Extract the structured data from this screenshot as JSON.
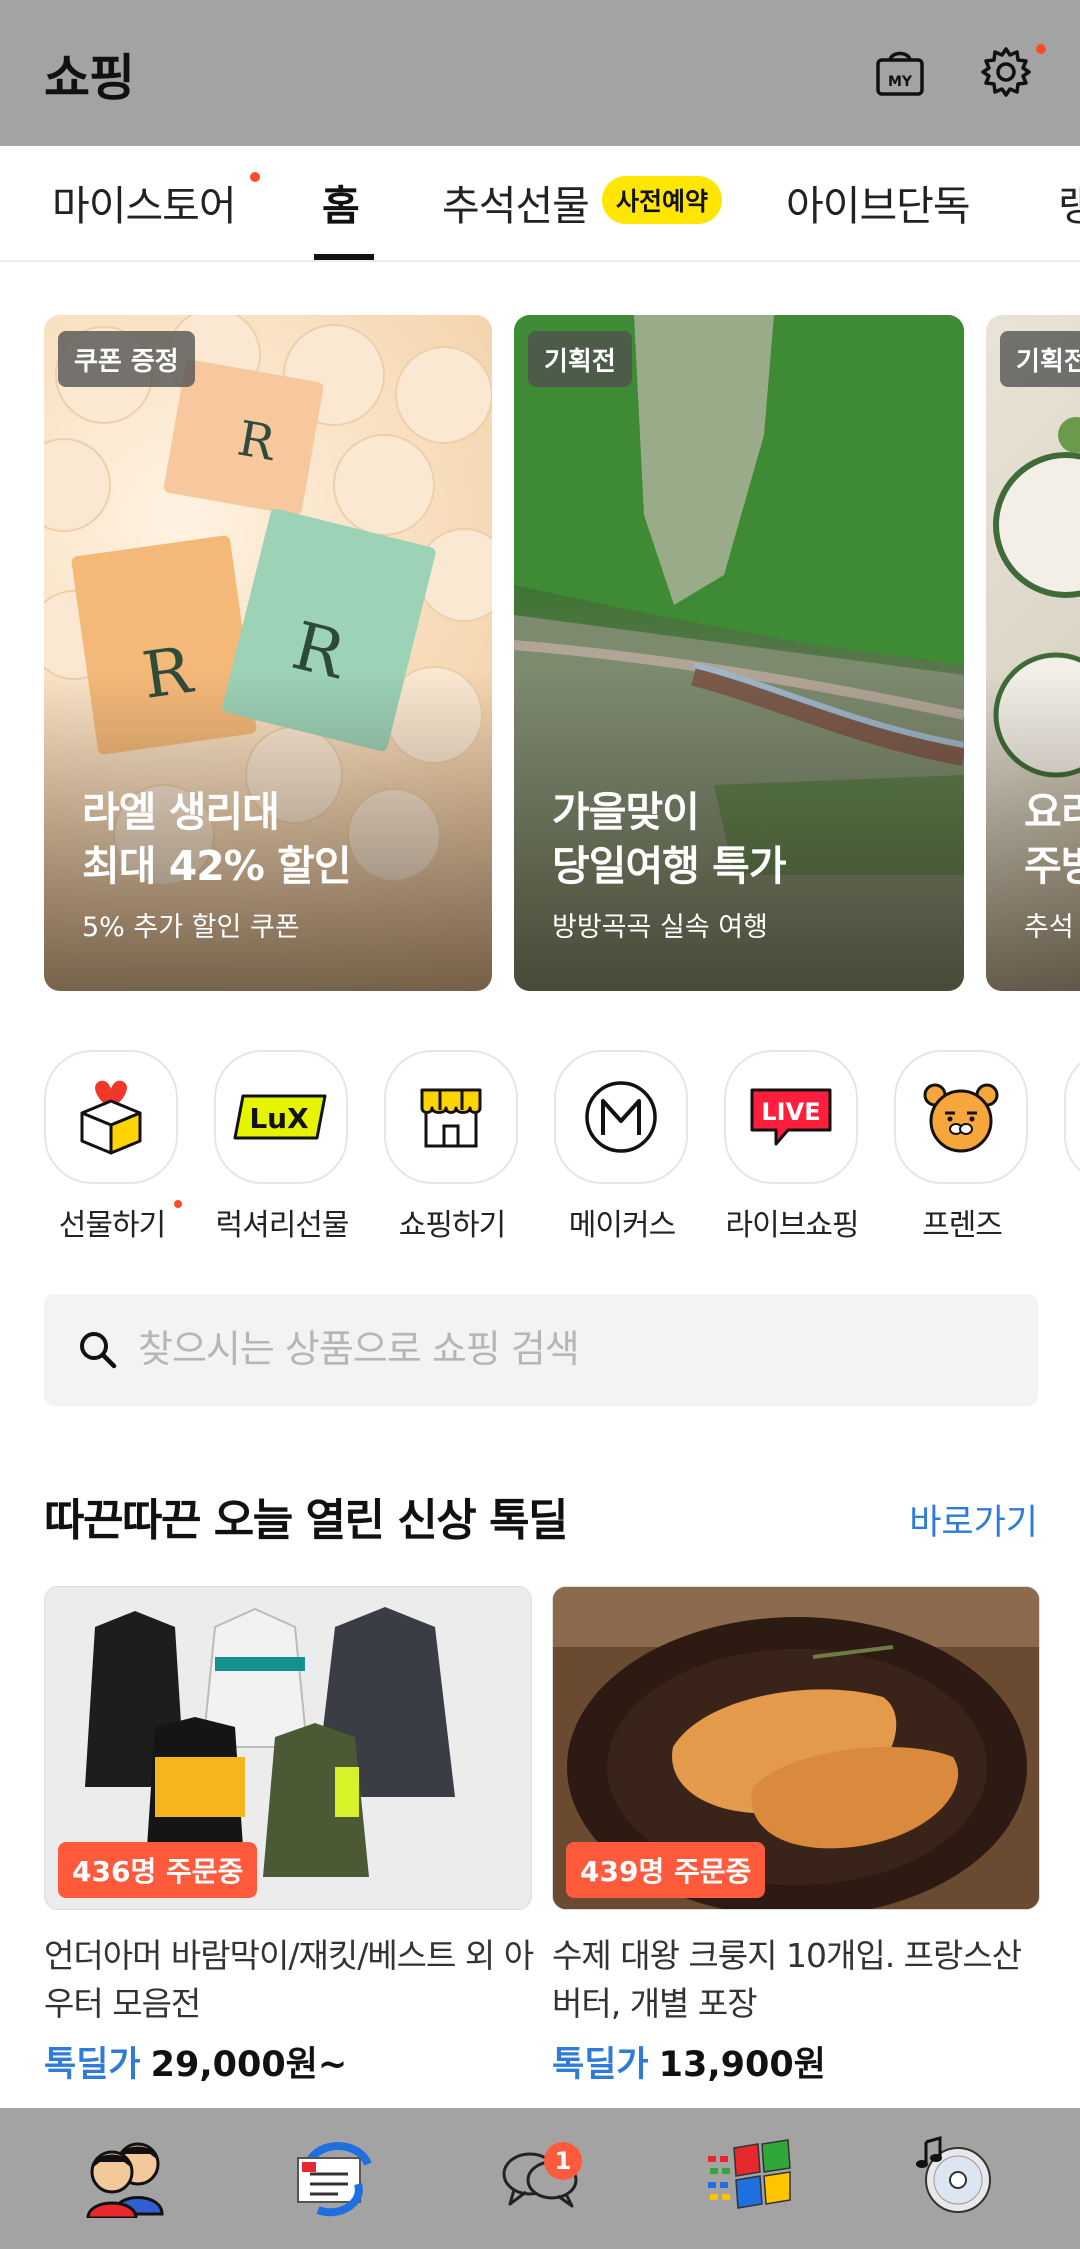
{
  "header": {
    "title": "쇼핑",
    "bag_icon": "my-shopping-bag-icon",
    "settings_icon": "gear-icon"
  },
  "tabs": [
    {
      "label": "마이스토어",
      "dot": true
    },
    {
      "label": "홈",
      "active": true
    },
    {
      "label": "추석선물",
      "badge": "사전예약"
    },
    {
      "label": "아이브단독"
    },
    {
      "label": "랭"
    }
  ],
  "banners": [
    {
      "tag": "쿠폰 증정",
      "title_line1": "라엘 생리대",
      "title_line2": "최대 42% 할인",
      "subtitle": "5% 추가 할인 쿠폰"
    },
    {
      "tag": "기획전",
      "title_line1": "가을맞이",
      "title_line2": "당일여행 특가",
      "subtitle": "방방곡곡 실속 여행"
    },
    {
      "tag": "기획전",
      "title_line1": "요리",
      "title_line2": "주방",
      "subtitle": "추석"
    }
  ],
  "quick_menu": [
    {
      "label": "선물하기",
      "icon": "gift-box-icon",
      "dot": true
    },
    {
      "label": "럭셔리선물",
      "icon": "lux-icon",
      "icon_text": "LuX"
    },
    {
      "label": "쇼핑하기",
      "icon": "store-icon"
    },
    {
      "label": "메이커스",
      "icon": "makers-m-icon"
    },
    {
      "label": "라이브쇼핑",
      "icon": "live-icon",
      "icon_text": "LIVE"
    },
    {
      "label": "프렌즈",
      "icon": "friends-ryan-icon"
    }
  ],
  "search": {
    "placeholder": "찾으시는 상품으로 쇼핑 검색"
  },
  "section": {
    "title": "따끈따끈 오늘 열린 신상 톡딜",
    "link": "바로가기"
  },
  "products": [
    {
      "badge": "436명 주문중",
      "name": "언더아머 바람막이/재킷/베스트 외 아우터 모음전",
      "deal_label": "톡딜가",
      "price": "29,000원~"
    },
    {
      "badge": "439명 주문중",
      "name": "수제 대왕 크룽지 10개입. 프랑스산 버터, 개별 포장",
      "deal_label": "톡딜가",
      "price": "13,900원"
    }
  ],
  "bottom_nav": [
    {
      "icon": "friends-icon"
    },
    {
      "icon": "chats-mail-icon"
    },
    {
      "icon": "chat-bubbles-icon",
      "badge": "1"
    },
    {
      "icon": "windows-flag-icon"
    },
    {
      "icon": "music-disc-icon"
    }
  ]
}
